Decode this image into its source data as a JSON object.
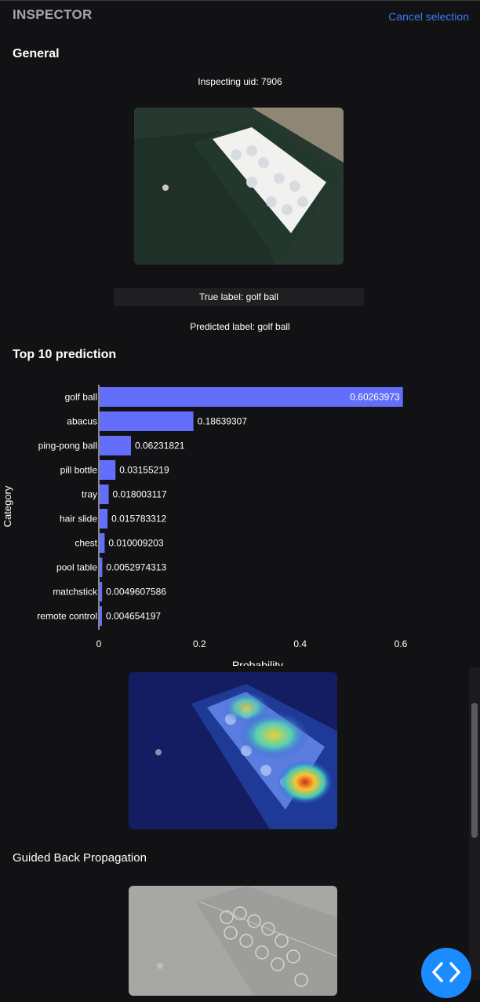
{
  "header": {
    "title": "INSPECTOR",
    "cancel_label": "Cancel selection"
  },
  "general": {
    "title": "General",
    "uid_text": "Inspecting uid: 7906",
    "true_label_text": "True label: golf ball",
    "predicted_label_text": "Predicted label: golf ball"
  },
  "prediction": {
    "title": "Top 10 prediction"
  },
  "guided": {
    "title": "Guided Back Propagation"
  },
  "icons": {
    "fab": "code-brackets-icon"
  },
  "colors": {
    "bar": "#636efa",
    "link": "#3b7bf6",
    "fab": "#1a8cff"
  },
  "chart_data": {
    "type": "bar",
    "orientation": "horizontal",
    "categories": [
      "golf ball",
      "abacus",
      "ping-pong ball",
      "pill bottle",
      "tray",
      "hair slide",
      "chest",
      "pool table",
      "matchstick",
      "remote control"
    ],
    "values": [
      0.60263973,
      0.18639307,
      0.06231821,
      0.03155219,
      0.018003117,
      0.015783312,
      0.010009203,
      0.0052974313,
      0.0049607586,
      0.004654197
    ],
    "labels": [
      "0.60263973",
      "0.18639307",
      "0.06231821",
      "0.03155219",
      "0.018003117",
      "0.015783312",
      "0.010009203",
      "0.0052974313",
      "0.0049607586",
      "0.004654197"
    ],
    "xlabel": "Probability",
    "ylabel": "Category",
    "xticks": [
      "0",
      "0.2",
      "0.4",
      "0.6"
    ],
    "xlim": [
      0,
      0.62
    ],
    "grid": false
  }
}
